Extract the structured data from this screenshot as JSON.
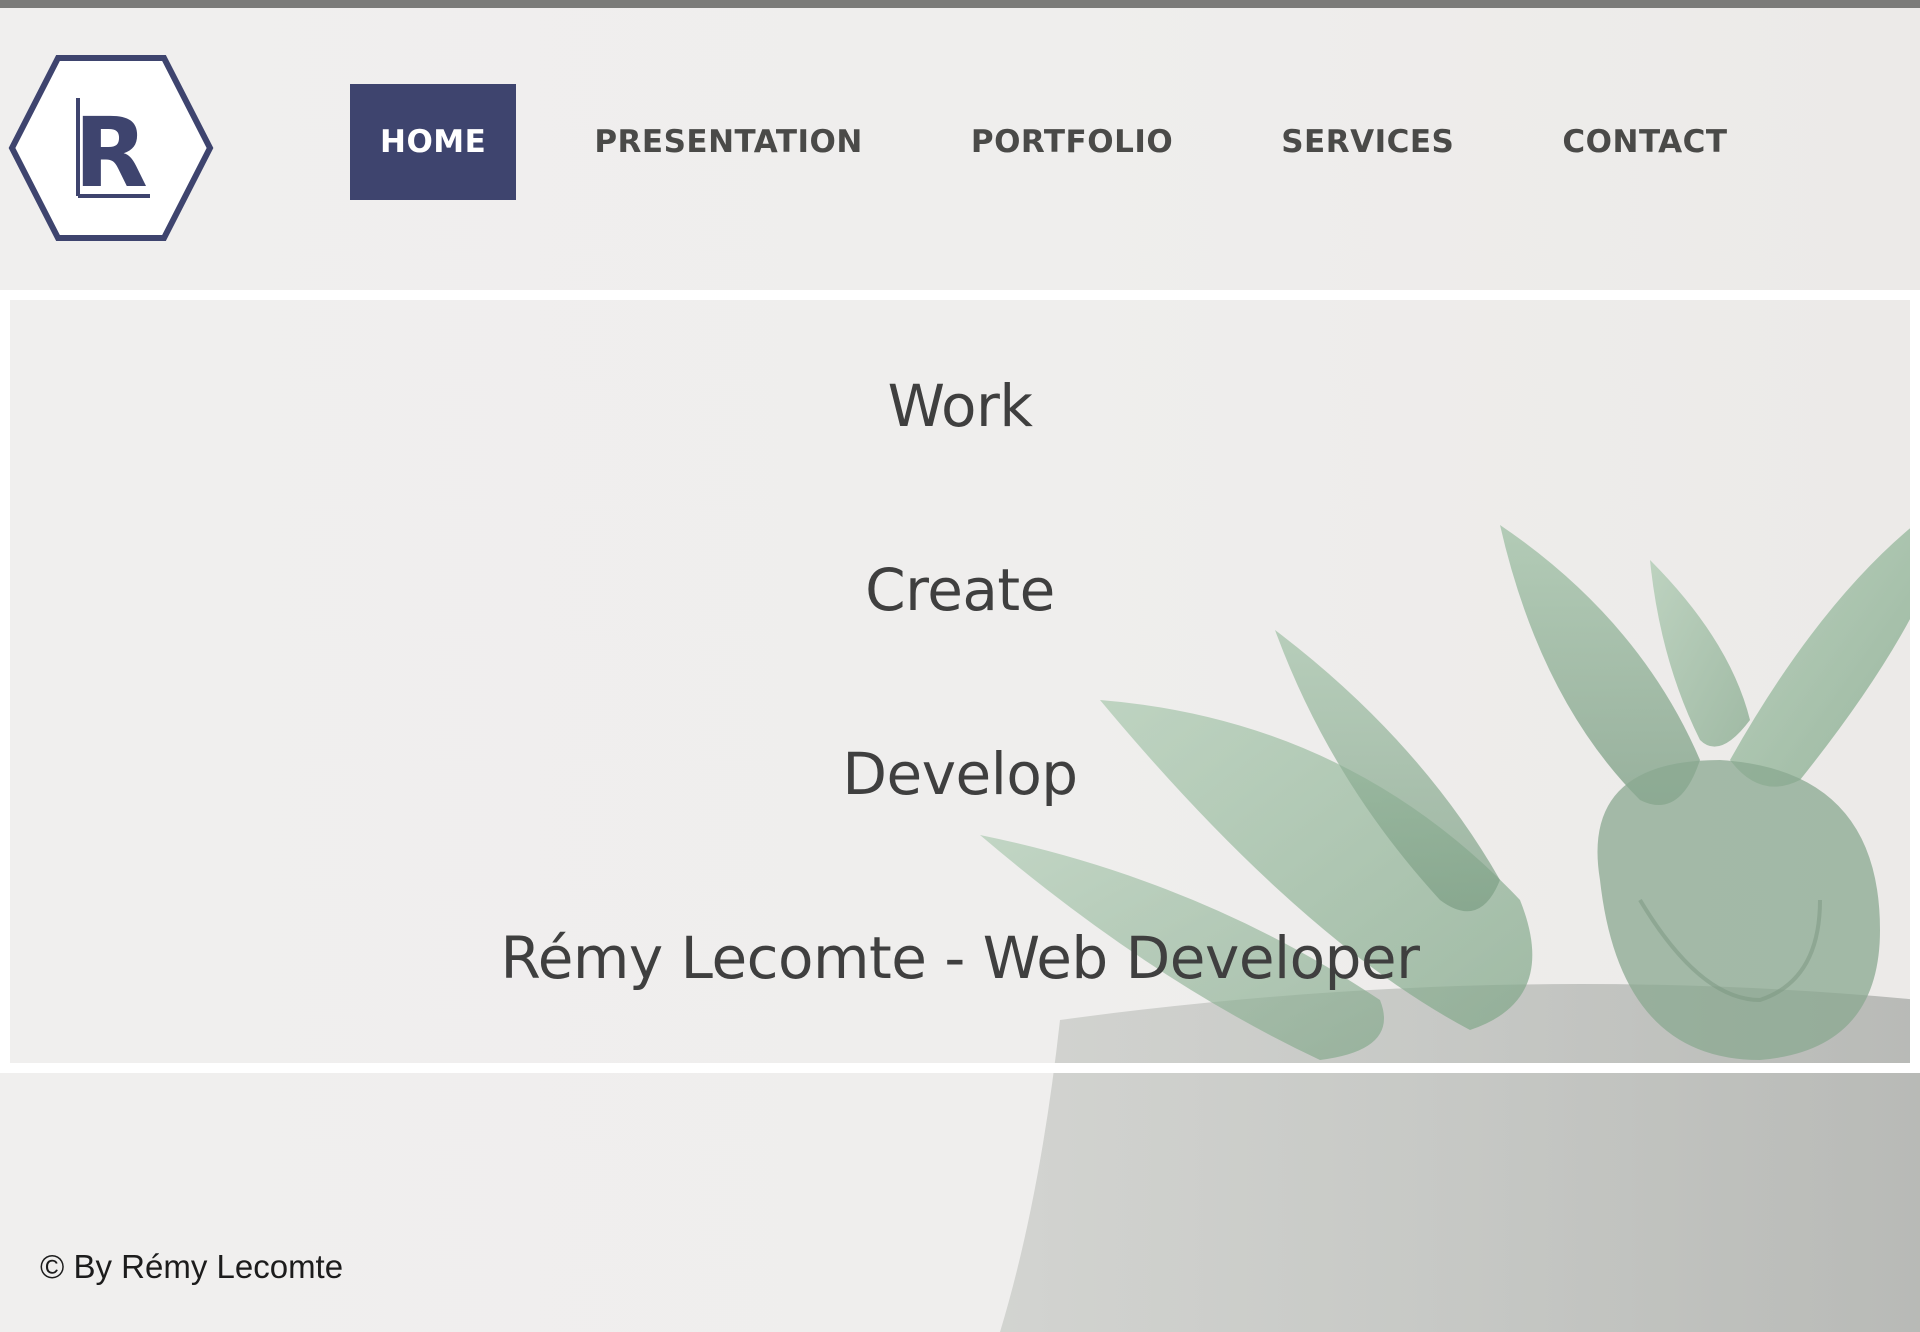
{
  "brand": {
    "logo_letter": "R"
  },
  "nav": {
    "items": [
      {
        "label": "HOME",
        "active": true
      },
      {
        "label": "PRESENTATION",
        "active": false
      },
      {
        "label": "PORTFOLIO",
        "active": false
      },
      {
        "label": "SERVICES",
        "active": false
      },
      {
        "label": "CONTACT",
        "active": false
      }
    ]
  },
  "hero": {
    "lines": [
      "Work",
      "Create",
      "Develop",
      "Rémy Lecomte - Web Developer"
    ]
  },
  "footer": {
    "copyright": "© By Rémy Lecomte"
  },
  "colors": {
    "accent": "#3e446e",
    "nav_text": "#4a4a48",
    "hero_text": "#3f3f3f",
    "plant_green": "#8fb59a",
    "frame": "#ffffff"
  },
  "icons": {
    "logo": "hexagon-logo-icon"
  }
}
